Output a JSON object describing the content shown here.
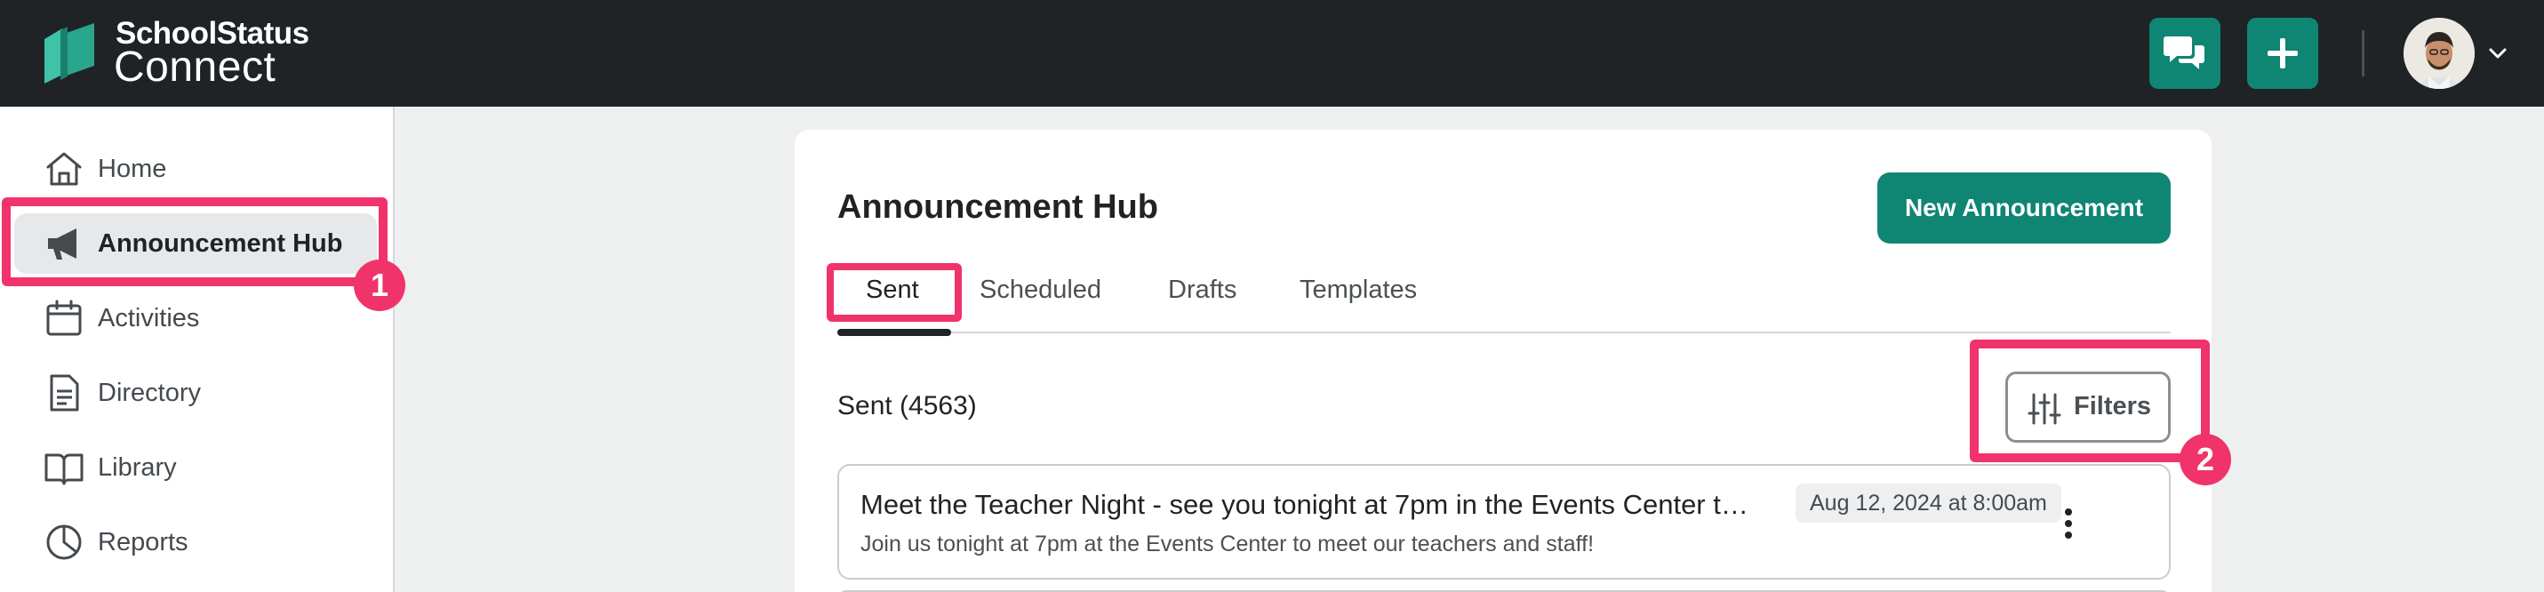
{
  "brand": {
    "name_top": "SchoolStatus",
    "name_bottom": "Connect"
  },
  "colors": {
    "topbar": "#1f2326",
    "accent": "#0f8574",
    "callout": "#f0336b",
    "sidebar_active": "#e6e8ea"
  },
  "header": {
    "messages_icon": "chat-bubbles-icon",
    "add_icon": "plus-icon",
    "profile_menu_icon": "chevron-down-icon"
  },
  "sidebar": {
    "items": [
      {
        "label": "Home",
        "icon": "home-icon",
        "active": false
      },
      {
        "label": "Announcement Hub",
        "icon": "megaphone-icon",
        "active": true
      },
      {
        "label": "Activities",
        "icon": "calendar-icon",
        "active": false
      },
      {
        "label": "Directory",
        "icon": "document-icon",
        "active": false
      },
      {
        "label": "Library",
        "icon": "book-icon",
        "active": false
      },
      {
        "label": "Reports",
        "icon": "pie-chart-icon",
        "active": false
      }
    ]
  },
  "main": {
    "title": "Announcement Hub",
    "new_button_label": "New Announcement",
    "tabs": [
      {
        "label": "Sent",
        "active": true
      },
      {
        "label": "Scheduled",
        "active": false
      },
      {
        "label": "Drafts",
        "active": false
      },
      {
        "label": "Templates",
        "active": false
      }
    ],
    "count_label": "Sent (4563)",
    "filters_label": "Filters",
    "announcements": [
      {
        "title": "Meet the Teacher Night - see you tonight at 7pm in the Events Center to kick off the new school year!",
        "date": "Aug 12, 2024 at 8:00am",
        "preview": "Join us tonight at 7pm at the Events Center to meet our teachers and staff!"
      }
    ]
  },
  "callouts": [
    {
      "number": "1"
    },
    {
      "number": "2"
    }
  ]
}
